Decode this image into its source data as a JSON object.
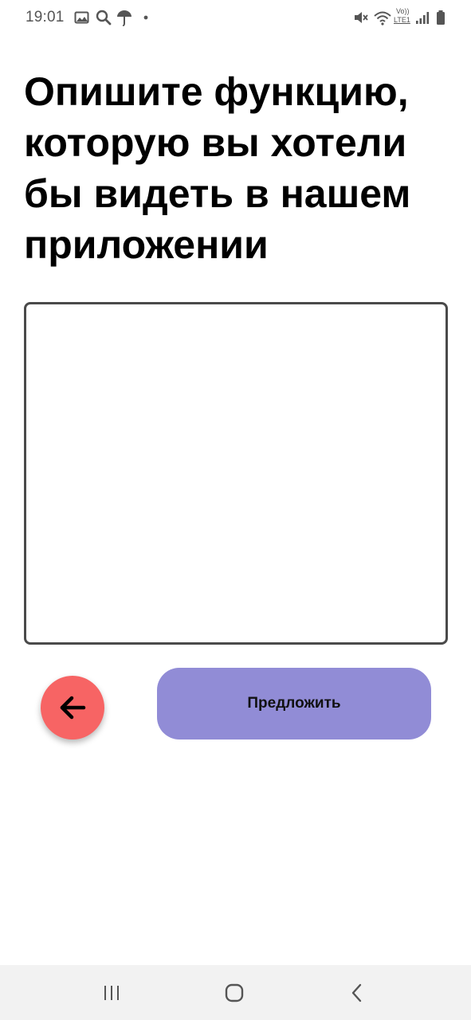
{
  "status_bar": {
    "time": "19:01",
    "left_icons": [
      "gallery-icon",
      "search-icon",
      "umbrella-icon",
      "dot-icon"
    ],
    "right_icons": [
      "mute-icon",
      "wifi-icon",
      "volte-lte-icon",
      "signal-icon",
      "battery-icon"
    ],
    "volte_label": "Vo))",
    "lte_label": "LTE1"
  },
  "page": {
    "title": "Опишите функцию, которую вы хотели бы видеть в нашем приложении",
    "feedback_value": "",
    "back_icon": "arrow-left-icon",
    "submit_label": "Предложить"
  },
  "nav_bar": {
    "items": [
      "recent-apps-icon",
      "home-icon",
      "back-icon"
    ]
  },
  "colors": {
    "back_button": "#f76464",
    "submit_button": "#918cd6",
    "text_area_border": "#4a4a4a",
    "nav_bar_bg": "#f2f2f2"
  }
}
